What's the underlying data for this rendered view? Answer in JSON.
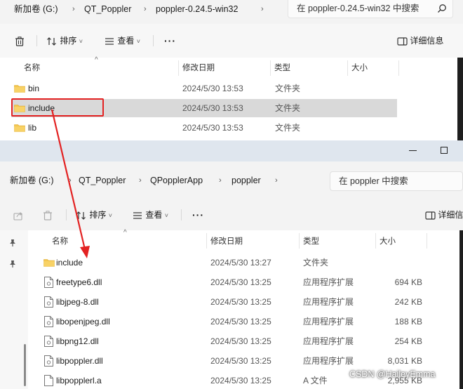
{
  "window1": {
    "breadcrumbs": [
      "新加卷 (G:)",
      "QT_Poppler",
      "poppler-0.24.5-win32"
    ],
    "search_placeholder": "在 poppler-0.24.5-win32 中搜索",
    "toolbar": {
      "sort_label": "排序",
      "view_label": "查看",
      "more_label": "···",
      "details_label": "详细信息"
    },
    "columns": {
      "name": "名称",
      "modified": "修改日期",
      "type": "类型",
      "size": "大小"
    },
    "rows": [
      {
        "name": "bin",
        "modified": "2024/5/30 13:53",
        "type": "文件夹"
      },
      {
        "name": "include",
        "modified": "2024/5/30 13:53",
        "type": "文件夹",
        "selected": true
      },
      {
        "name": "lib",
        "modified": "2024/5/30 13:53",
        "type": "文件夹"
      }
    ]
  },
  "window2": {
    "breadcrumbs": [
      "新加卷 (G:)",
      "QT_Poppler",
      "QPopplerApp",
      "poppler"
    ],
    "search_placeholder": "在 poppler 中搜索",
    "toolbar": {
      "sort_label": "排序",
      "view_label": "查看",
      "more_label": "···",
      "details_label": "详细信息"
    },
    "columns": {
      "name": "名称",
      "modified": "修改日期",
      "type": "类型",
      "size": "大小"
    },
    "rows": [
      {
        "name": "include",
        "modified": "2024/5/30 13:27",
        "type": "文件夹",
        "size": "",
        "kind": "folder"
      },
      {
        "name": "freetype6.dll",
        "modified": "2024/5/30 13:25",
        "type": "应用程序扩展",
        "size": "694 KB",
        "kind": "dll"
      },
      {
        "name": "libjpeg-8.dll",
        "modified": "2024/5/30 13:25",
        "type": "应用程序扩展",
        "size": "242 KB",
        "kind": "dll"
      },
      {
        "name": "libopenjpeg.dll",
        "modified": "2024/5/30 13:25",
        "type": "应用程序扩展",
        "size": "188 KB",
        "kind": "dll"
      },
      {
        "name": "libpng12.dll",
        "modified": "2024/5/30 13:25",
        "type": "应用程序扩展",
        "size": "254 KB",
        "kind": "dll"
      },
      {
        "name": "libpoppler.dll",
        "modified": "2024/5/30 13:25",
        "type": "应用程序扩展",
        "size": "8,031 KB",
        "kind": "dll"
      },
      {
        "name": "libpopplerl.a",
        "modified": "2024/5/30 13:25",
        "type": "A 文件",
        "size": "2,955 KB",
        "kind": "file"
      }
    ]
  },
  "colors": {
    "annotation_red": "#e32222",
    "folder_yellow": "#f4c64e",
    "selection": "#d9d9d9"
  },
  "watermark": "CSDN @HaileyEmma"
}
